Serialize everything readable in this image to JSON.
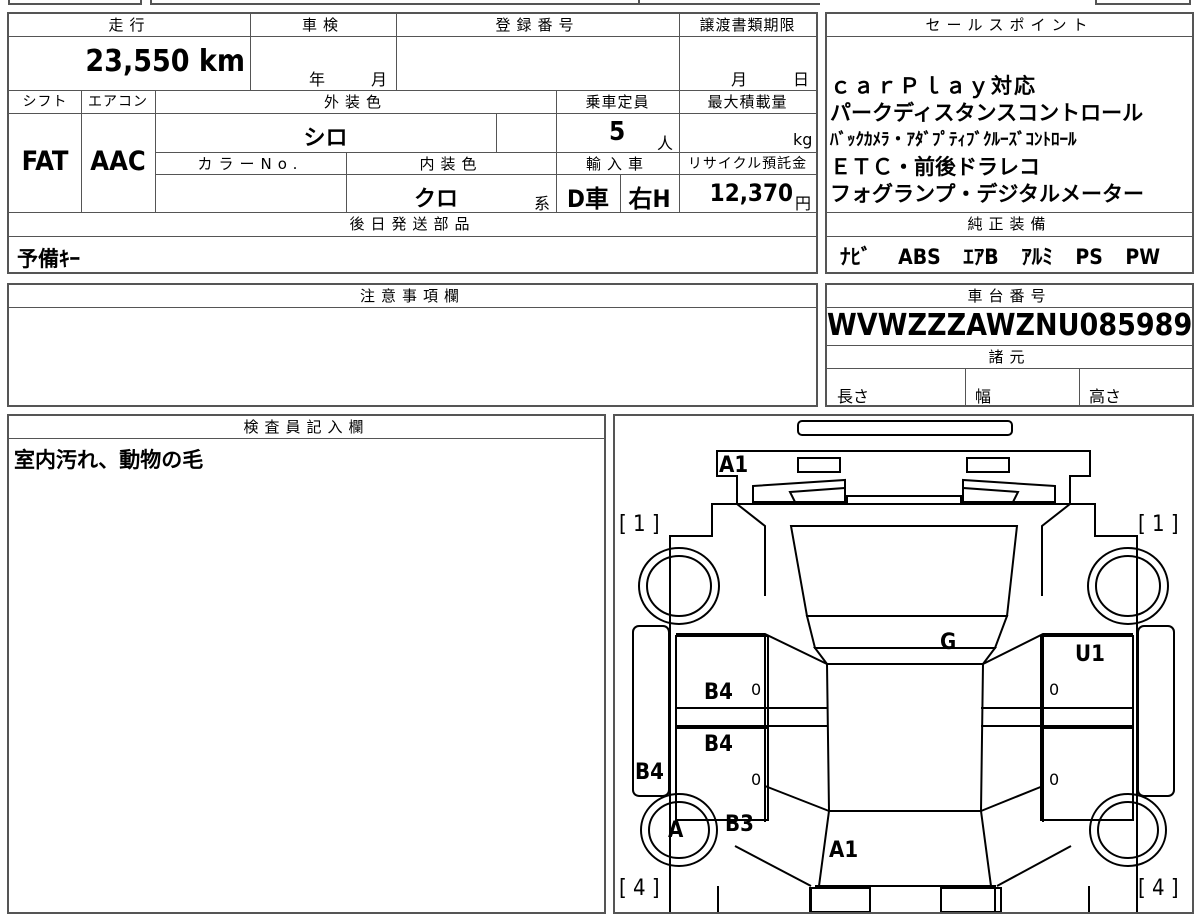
{
  "headers": {
    "mileage": "走行",
    "inspection": "車検",
    "registration": "登録番号",
    "transfer_deadline": "譲渡書類期限",
    "sales_points": "セールスポイント",
    "shift": "シフト",
    "aircon": "エアコン",
    "exterior_color": "外装色",
    "capacity": "乗車定員",
    "max_load": "最大積載量",
    "color_no": "カラーNo.",
    "interior_color": "内装色",
    "import": "輸入車",
    "recycle": "リサイクル預託金",
    "later_parts": "後日発送部品",
    "standard_equipment": "純正装備",
    "notes": "注意事項欄",
    "chassis": "車台番号",
    "specs": "諸元",
    "inspector": "検査員記入欄"
  },
  "values": {
    "mileage": "23,550 km",
    "inspection_year": "年",
    "inspection_month": "月",
    "deadline_month": "月",
    "deadline_day": "日",
    "shift": "FAT",
    "aircon": "AAC",
    "exterior_color": "シロ",
    "capacity": "5",
    "capacity_unit": "人",
    "load_unit": "kg",
    "interior_color": "クロ",
    "interior_suffix": "系",
    "import_type": "D車",
    "handle": "右H",
    "recycle_fee": "12,370",
    "recycle_unit": "円",
    "later_parts": "予備ｷｰ",
    "chassis_no": "WVWZZZAWZNU085989",
    "length": "長さ",
    "width": "幅",
    "height": "高さ",
    "inspector_note": "室内汚れ、動物の毛"
  },
  "sales_points": [
    "ｃａｒＰｌａｙ対応",
    "パークディスタンスコントロール",
    "ﾊﾞｯｸｶﾒﾗ・ｱﾀﾞﾌﾟﾃｨﾌﾞｸﾙｰｽﾞｺﾝﾄﾛｰﾙ",
    "ＥＴＣ・前後ドラレコ",
    "フォグランプ・デジタルメーター"
  ],
  "equipment": [
    "ﾅﾋﾞ",
    "ABS",
    "ｴｱB",
    "ｱﾙﾐ",
    "PS",
    "PW"
  ],
  "diagram": {
    "corner_tl": "[ 1 ]",
    "corner_tr": "[ 1 ]",
    "corner_bl": "[ 4 ]",
    "corner_br": "[ 4 ]",
    "a1_front": "A1",
    "g_windshield": "G",
    "u1": "U1",
    "b4_front_left": "B4",
    "b4_rear_left": "B4",
    "b4_left_side": "B4",
    "a_wheel": "A",
    "b3": "B3",
    "a1_rear": "A1",
    "zero_1": "0",
    "zero_2": "0",
    "zero_3": "0",
    "zero_4": "0"
  }
}
